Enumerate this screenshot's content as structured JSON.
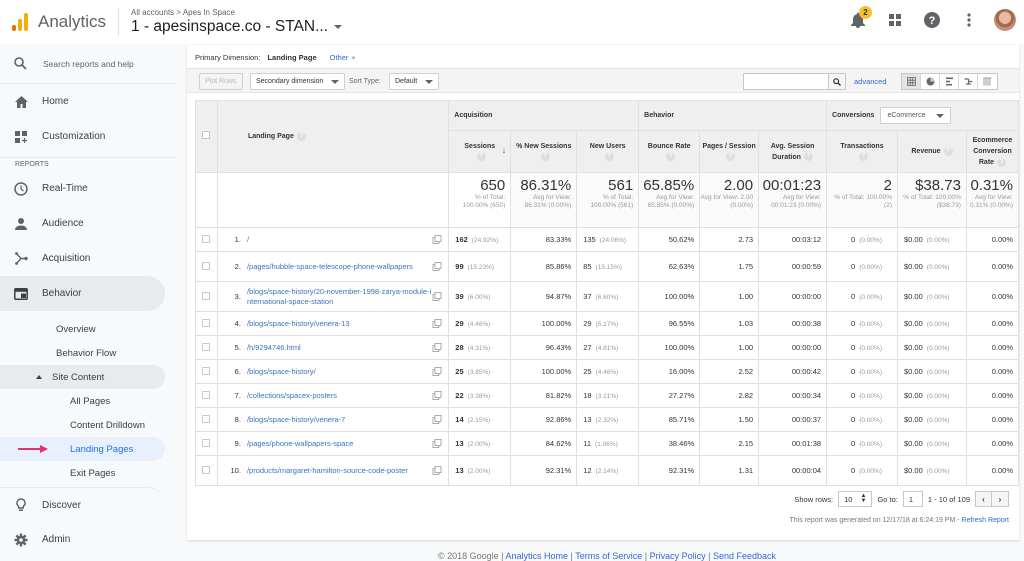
{
  "header": {
    "app_name": "Analytics",
    "breadcrumb": "All accounts > Apes In Space",
    "account_title": "1 - apesinspace.co - STAN...",
    "notification_count": "2",
    "brand_colors": {
      "logo_bar_1": "#e37400",
      "logo_bar_2": "#f9ab00",
      "logo_bar_3": "#f9ab00"
    }
  },
  "sidebar": {
    "search_placeholder": "Search reports and help",
    "items_top": [
      {
        "label": "Home",
        "icon": "home-icon"
      },
      {
        "label": "Customization",
        "icon": "customization-icon"
      }
    ],
    "reports_label": "REPORTS",
    "reports": [
      {
        "label": "Real-Time",
        "icon": "clock-icon"
      },
      {
        "label": "Audience",
        "icon": "person-icon"
      },
      {
        "label": "Acquisition",
        "icon": "acquisition-icon"
      },
      {
        "label": "Behavior",
        "icon": "behavior-icon"
      }
    ],
    "behavior_sub": [
      "Overview",
      "Behavior Flow"
    ],
    "site_content_label": "Site Content",
    "site_content_sub": [
      "All Pages",
      "Content Drilldown",
      "Landing Pages",
      "Exit Pages"
    ],
    "bottom": [
      {
        "label": "Discover",
        "icon": "lightbulb-icon"
      },
      {
        "label": "Admin",
        "icon": "gear-icon"
      }
    ]
  },
  "report": {
    "primary_dimension_label": "Primary Dimension:",
    "primary_dimension_value": "Landing Page",
    "other_label": "Other",
    "plot_rows": "Plot Rows",
    "secondary_dimension": "Secondary dimension",
    "sort_type_label": "Sort Type:",
    "sort_type_value": "Default",
    "search_value": "",
    "advanced": "advanced",
    "group_headers": {
      "acquisition": "Acquisition",
      "behavior": "Behavior",
      "conversions": "Conversions",
      "conversions_select": "eCommerce"
    },
    "columns": {
      "landing_page": "Landing Page",
      "sessions": "Sessions",
      "pct_new_sessions": "% New Sessions",
      "new_users": "New Users",
      "bounce_rate": "Bounce Rate",
      "pages_session": "Pages / Session",
      "avg_session_duration": "Avg. Session Duration",
      "transactions": "Transactions",
      "revenue": "Revenue",
      "ecommerce_conversion_rate": "Ecommerce Conversion Rate"
    },
    "totals": {
      "sessions": {
        "value": "650",
        "sub": "% of Total: 100.00% (650)"
      },
      "pct_new_sessions": {
        "value": "86.31%",
        "sub": "Avg for View: 86.31% (0.00%)"
      },
      "new_users": {
        "value": "561",
        "sub": "% of Total: 100.00% (561)"
      },
      "bounce_rate": {
        "value": "65.85%",
        "sub": "Avg for View: 65.85% (0.00%)"
      },
      "pages_session": {
        "value": "2.00",
        "sub": "Avg for View: 2.00 (0.00%)"
      },
      "avg_session_duration": {
        "value": "00:01:23",
        "sub": "Avg for View: 00:01:23 (0.00%)"
      },
      "transactions": {
        "value": "2",
        "sub": "% of Total: 100.00% (2)"
      },
      "revenue": {
        "value": "$38.73",
        "sub": "% of Total: 100.00% ($38.73)"
      },
      "ecommerce_conversion_rate": {
        "value": "0.31%",
        "sub": "Avg for View: 0.31% (0.00%)"
      }
    },
    "rows": [
      {
        "idx": "1.",
        "page": "/",
        "sessions": "162",
        "sessions_pct": "(24.92%)",
        "pct_new": "83.33%",
        "new_users": "135",
        "new_users_pct": "(24.06%)",
        "bounce": "50.62%",
        "pps": "2.73",
        "dur": "00:03:12",
        "tx": "0",
        "tx_pct": "(0.00%)",
        "rev": "$0.00",
        "rev_pct": "(0.00%)",
        "ecr": "0.00%"
      },
      {
        "idx": "2.",
        "page": "/pages/hubble-space-telescope-phone-wallpapers",
        "sessions": "99",
        "sessions_pct": "(15.23%)",
        "pct_new": "85.86%",
        "new_users": "85",
        "new_users_pct": "(15.15%)",
        "bounce": "62.63%",
        "pps": "1.75",
        "dur": "00:00:59",
        "tx": "0",
        "tx_pct": "(0.00%)",
        "rev": "$0.00",
        "rev_pct": "(0.00%)",
        "ecr": "0.00%"
      },
      {
        "idx": "3.",
        "page": "/blogs/space-history/20-november-1998-zarya-module-international-space-station",
        "sessions": "39",
        "sessions_pct": "(6.00%)",
        "pct_new": "94.87%",
        "new_users": "37",
        "new_users_pct": "(6.60%)",
        "bounce": "100.00%",
        "pps": "1.00",
        "dur": "00:00:00",
        "tx": "0",
        "tx_pct": "(0.00%)",
        "rev": "$0.00",
        "rev_pct": "(0.00%)",
        "ecr": "0.00%"
      },
      {
        "idx": "4.",
        "page": "/blogs/space-history/venera-13",
        "sessions": "29",
        "sessions_pct": "(4.46%)",
        "pct_new": "100.00%",
        "new_users": "29",
        "new_users_pct": "(5.17%)",
        "bounce": "96.55%",
        "pps": "1.03",
        "dur": "00:00:38",
        "tx": "0",
        "tx_pct": "(0.00%)",
        "rev": "$0.00",
        "rev_pct": "(0.00%)",
        "ecr": "0.00%"
      },
      {
        "idx": "5.",
        "page": "/h/9294746.html",
        "sessions": "28",
        "sessions_pct": "(4.31%)",
        "pct_new": "96.43%",
        "new_users": "27",
        "new_users_pct": "(4.81%)",
        "bounce": "100.00%",
        "pps": "1.00",
        "dur": "00:00:00",
        "tx": "0",
        "tx_pct": "(0.00%)",
        "rev": "$0.00",
        "rev_pct": "(0.00%)",
        "ecr": "0.00%"
      },
      {
        "idx": "6.",
        "page": "/blogs/space-history/",
        "sessions": "25",
        "sessions_pct": "(3.85%)",
        "pct_new": "100.00%",
        "new_users": "25",
        "new_users_pct": "(4.46%)",
        "bounce": "16.00%",
        "pps": "2.52",
        "dur": "00:00:42",
        "tx": "0",
        "tx_pct": "(0.00%)",
        "rev": "$0.00",
        "rev_pct": "(0.00%)",
        "ecr": "0.00%"
      },
      {
        "idx": "7.",
        "page": "/collections/spacex-posters",
        "sessions": "22",
        "sessions_pct": "(3.38%)",
        "pct_new": "81.82%",
        "new_users": "18",
        "new_users_pct": "(3.21%)",
        "bounce": "27.27%",
        "pps": "2.82",
        "dur": "00:00:34",
        "tx": "0",
        "tx_pct": "(0.00%)",
        "rev": "$0.00",
        "rev_pct": "(0.00%)",
        "ecr": "0.00%"
      },
      {
        "idx": "8.",
        "page": "/blogs/space-history/venera-7",
        "sessions": "14",
        "sessions_pct": "(2.15%)",
        "pct_new": "92.86%",
        "new_users": "13",
        "new_users_pct": "(2.32%)",
        "bounce": "85.71%",
        "pps": "1.50",
        "dur": "00:00:37",
        "tx": "0",
        "tx_pct": "(0.00%)",
        "rev": "$0.00",
        "rev_pct": "(0.00%)",
        "ecr": "0.00%"
      },
      {
        "idx": "9.",
        "page": "/pages/phone-wallpapers-space",
        "sessions": "13",
        "sessions_pct": "(2.00%)",
        "pct_new": "84.62%",
        "new_users": "11",
        "new_users_pct": "(1.96%)",
        "bounce": "38.46%",
        "pps": "2.15",
        "dur": "00:01:38",
        "tx": "0",
        "tx_pct": "(0.00%)",
        "rev": "$0.00",
        "rev_pct": "(0.00%)",
        "ecr": "0.00%"
      },
      {
        "idx": "10.",
        "page": "/products/margaret-hamilton-source-code-poster",
        "sessions": "13",
        "sessions_pct": "(2.00%)",
        "pct_new": "92.31%",
        "new_users": "12",
        "new_users_pct": "(2.14%)",
        "bounce": "92.31%",
        "pps": "1.31",
        "dur": "00:00:04",
        "tx": "0",
        "tx_pct": "(0.00%)",
        "rev": "$0.00",
        "rev_pct": "(0.00%)",
        "ecr": "0.00%"
      }
    ],
    "pagination": {
      "show_rows_label": "Show rows:",
      "show_rows_value": "10",
      "goto_label": "Go to:",
      "goto_value": "1",
      "range": "1 - 10 of 109"
    },
    "generated_text": "This report was generated on 12/17/18 at 6:24:19 PM - ",
    "refresh_label": "Refresh Report"
  },
  "footer": {
    "copyright": "© 2018 Google",
    "links": [
      "Analytics Home",
      "Terms of Service",
      "Privacy Policy",
      "Send Feedback"
    ]
  }
}
